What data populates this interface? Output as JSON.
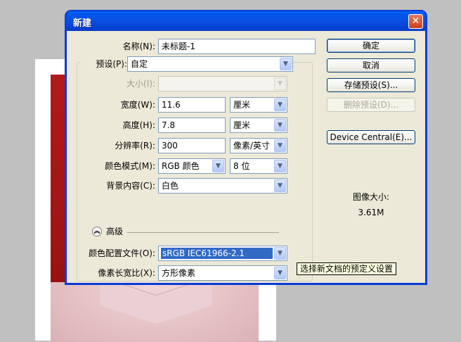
{
  "window": {
    "title": "新建"
  },
  "fields": {
    "name": {
      "label": "名称(N):",
      "value": "未标题-1"
    },
    "preset": {
      "label": "预设(P):",
      "value": "自定"
    },
    "size": {
      "label": "大小(I):",
      "value": ""
    },
    "width": {
      "label": "宽度(W):",
      "value": "11.6",
      "unit": "厘米"
    },
    "height": {
      "label": "高度(H):",
      "value": "7.8",
      "unit": "厘米"
    },
    "resolution": {
      "label": "分辨率(R):",
      "value": "300",
      "unit": "像素/英寸"
    },
    "color_mode": {
      "label": "颜色模式(M):",
      "value": "RGB 颜色",
      "bits": "8 位"
    },
    "background": {
      "label": "背景内容(C):",
      "value": "白色"
    },
    "advanced": {
      "label": "高级"
    },
    "color_profile": {
      "label": "颜色配置文件(O):",
      "value": "sRGB IEC61966-2.1"
    },
    "pixel_aspect": {
      "label": "像素长宽比(X):",
      "value": "方形像素"
    }
  },
  "buttons": {
    "ok": "确定",
    "cancel": "取消",
    "save_preset": "存储预设(S)...",
    "delete_preset": "删除预设(D)...",
    "device_central": "Device Central(E)..."
  },
  "image_size": {
    "label": "图像大小:",
    "value": "3.61M"
  },
  "tooltip": "选择新文档的预定义设置",
  "colors": {
    "titlebar": "#0054e3",
    "dialog_bg": "#ece9d8",
    "selection": "#316ac5"
  }
}
